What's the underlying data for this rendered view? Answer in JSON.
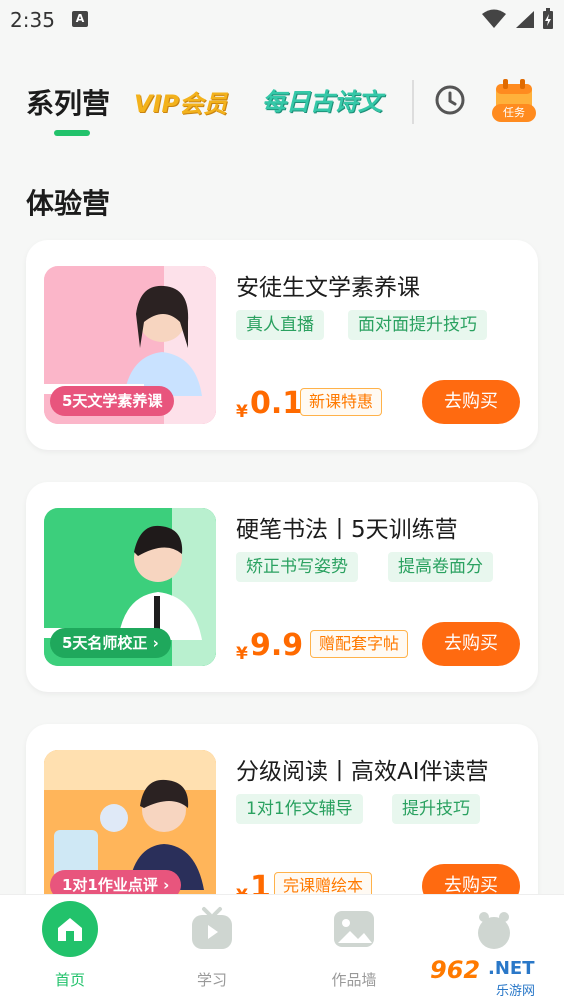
{
  "status_bar": {
    "time": "2:35",
    "notification_letter": "A"
  },
  "top_tabs": {
    "series": "系列营",
    "vip": "VIP会员",
    "poem": "每日古诗文",
    "task_badge": "任务"
  },
  "section": {
    "title": "体验营"
  },
  "cards": [
    {
      "title": "安徒生文学素养课",
      "image_label": "5天文学素养课",
      "tags": [
        "真人直播",
        "面对面提升技巧"
      ],
      "currency": "¥",
      "price": "0.1",
      "promo": "新课特惠",
      "buy": "去购买",
      "theme_color": "#f47aa0"
    },
    {
      "title": "硬笔书法丨5天训练营",
      "image_label": "5天名师校正 ›",
      "tags": [
        "矫正书写姿势",
        "提高卷面分"
      ],
      "currency": "¥",
      "price": "9.9",
      "promo": "赠配套字帖",
      "buy": "去购买",
      "theme_color": "#2fc46f"
    },
    {
      "title": "分级阅读丨高效AI伴读营",
      "image_label": "1对1作业点评 ›",
      "tags": [
        "1对1作文辅导",
        "提升技巧"
      ],
      "currency": "¥",
      "price": "1",
      "promo": "完课赠绘本",
      "buy": "去购买",
      "theme_color": "#ffa63a"
    }
  ],
  "bottom_nav": [
    {
      "label": "首页",
      "icon": "home-icon",
      "active": true
    },
    {
      "label": "学习",
      "icon": "tv-play-icon",
      "active": false
    },
    {
      "label": "作品墙",
      "icon": "picture-icon",
      "active": false
    },
    {
      "label": "",
      "icon": "profile-icon",
      "active": false
    }
  ],
  "watermark": {
    "logo": "962",
    "net": ".NET",
    "sub": "乐游网"
  },
  "colors": {
    "accent_green": "#22c26b",
    "price_orange": "#ff6a00",
    "buy_button": "#ff6a10"
  }
}
